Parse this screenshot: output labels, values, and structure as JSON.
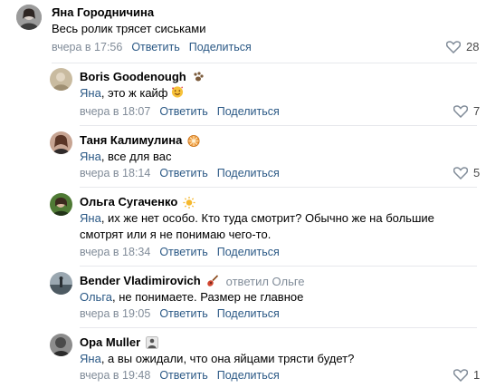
{
  "comments": [
    {
      "author": "Яна Городничина",
      "text": "Весь ролик трясет сиськами",
      "mention": "",
      "date": "вчера в 17:56",
      "reply_label": "Ответить",
      "share_label": "Поделиться",
      "likes": "28",
      "avatar_color": "#8a8a8a"
    },
    {
      "author": "Boris Goodenough",
      "mention": "Яна",
      "text": ", это ж кайф",
      "date": "вчера в 18:07",
      "reply_label": "Ответить",
      "share_label": "Поделиться",
      "likes": "7",
      "avatar_color": "#b5a689"
    },
    {
      "author": "Таня Калимулина",
      "mention": "Яна",
      "text": ", все для вас",
      "date": "вчера в 18:14",
      "reply_label": "Ответить",
      "share_label": "Поделиться",
      "likes": "5",
      "avatar_color": "#a67f6e"
    },
    {
      "author": "Ольга Сугаченко",
      "mention": "Яна",
      "text": ", их же нет особо. Кто туда смотрит? Обычно же на большие смотрят или я не понимаю чего-то.",
      "date": "вчера в 18:34",
      "reply_label": "Ответить",
      "share_label": "Поделиться",
      "likes": "",
      "avatar_color": "#5b7a43"
    },
    {
      "author": "Bender Vladimirovich",
      "replied_to": "ответил Ольге",
      "mention": "Ольга",
      "text": ", не понимаете. Размер не главное",
      "date": "вчера в 19:05",
      "reply_label": "Ответить",
      "share_label": "Поделиться",
      "likes": "",
      "avatar_color": "#7d8a93"
    },
    {
      "author": "Opa Muller",
      "mention": "Яна",
      "text": ", а вы ожидали, что она яйцами трясти будет?",
      "date": "вчера в 19:48",
      "reply_label": "Ответить",
      "share_label": "Поделиться",
      "likes": "1",
      "avatar_color": "#6e6e6e"
    }
  ],
  "colors": {
    "link": "#2a5885",
    "meta": "#818c99",
    "divider": "#e7e8ec"
  },
  "icons": {
    "like": "heart-outline-icon"
  }
}
